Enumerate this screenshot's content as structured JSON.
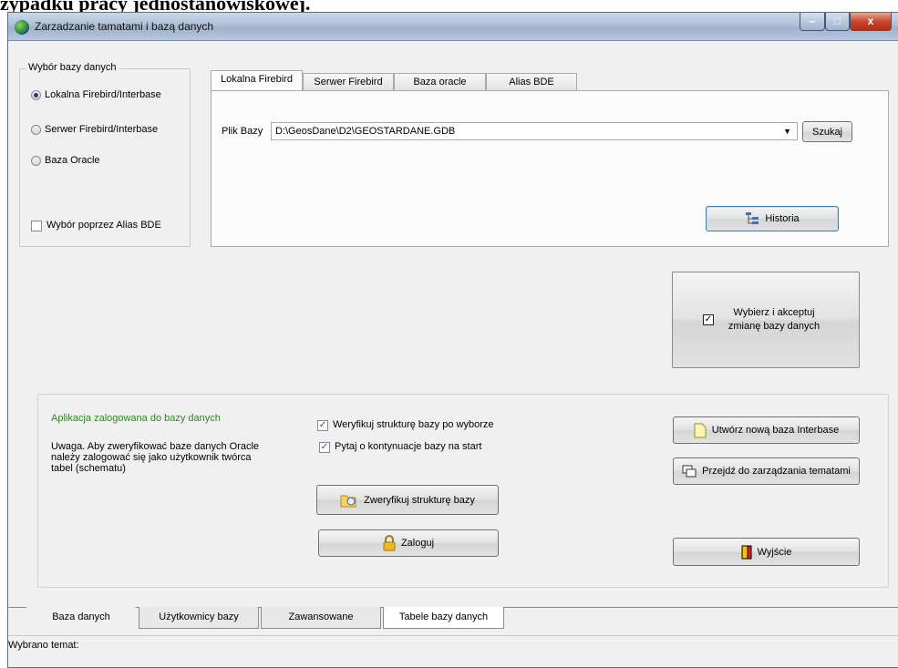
{
  "document": {
    "heading": "zypadku pracy jednostanowiskowej."
  },
  "window": {
    "title": "Zarzadzanie tamatami i bazą danych",
    "controls": {
      "minimize": "–",
      "maximize": "□",
      "close": "x"
    }
  },
  "db_choice": {
    "legend": "Wybór bazy danych",
    "options": [
      {
        "label": "Lokalna Firebird/Interbase",
        "selected": true
      },
      {
        "label": "Serwer Firebird/Interbase",
        "selected": false
      },
      {
        "label": "Baza Oracle",
        "selected": false
      }
    ],
    "alias_checkbox": {
      "label": "Wybór poprzez Alias BDE",
      "checked": false
    }
  },
  "connection_tabs": [
    "Lokalna Firebird",
    "Serwer Firebird",
    "Baza oracle",
    "Alias BDE"
  ],
  "local_panel": {
    "file_label": "Plik Bazy",
    "file_value": "D:\\GeosDane\\D2\\GEOSTARDANE.GDB",
    "browse_button": "Szukaj",
    "history_button": "Historia"
  },
  "accept_button": "Wybierz i akceptuj zmianę bazy danych",
  "status_panel": {
    "logged_in_text": "Aplikacja zalogowana do bazy danych",
    "note": "Uwaga. Aby zweryfikować baze danych Oracle należy zalogować się jako użytkownik twórca  tabel (schematu)",
    "verify_on_select": {
      "label": "Weryfikuj strukturę bazy po wyborze",
      "checked": true
    },
    "ask_continue": {
      "label": "Pytaj o kontynuacje bazy na start",
      "checked": true
    },
    "verify_button": "Zweryfikuj strukturę bazy",
    "login_button": "Zaloguj",
    "create_button": "Utwórz nową baza Interbase",
    "goto_topics_button": "Przejdź do zarządzania tematami",
    "exit_button": "Wyjście"
  },
  "bottom_tabs": [
    "Baza danych",
    "Użytkownicy bazy",
    "Zawansowane",
    "Tabele bazy danych"
  ],
  "status_bar": {
    "text": "Wybrano temat:"
  },
  "colors": {
    "logged_in": "#2a8a1c",
    "title_bar": "#aebfd6",
    "close": "#c8492e"
  }
}
